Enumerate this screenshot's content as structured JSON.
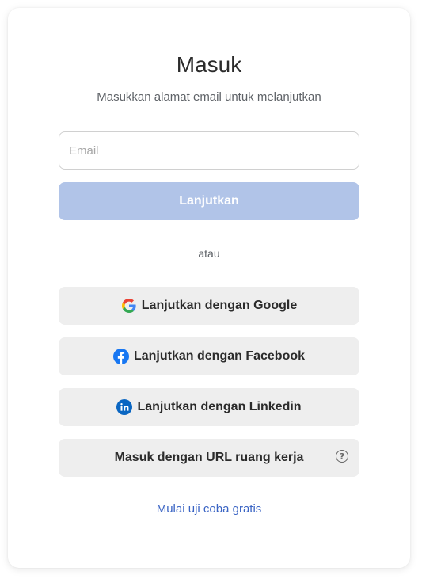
{
  "header": {
    "title": "Masuk",
    "subtitle": "Masukkan alamat email untuk melanjutkan"
  },
  "form": {
    "email_placeholder": "Email",
    "email_value": "",
    "continue_label": "Lanjutkan"
  },
  "divider": "atau",
  "social": {
    "google_label": "Lanjutkan dengan Google",
    "facebook_label": "Lanjutkan dengan Facebook",
    "linkedin_label": "Lanjutkan dengan Linkedin",
    "workspace_label": "Masuk dengan URL ruang kerja"
  },
  "footer": {
    "trial_link": "Mulai uji coba gratis"
  },
  "colors": {
    "primary_disabled": "#b1c4e8",
    "link": "#3a64c4",
    "facebook": "#1877f2",
    "linkedin": "#0a66c2"
  },
  "icons": {
    "google": "google-icon",
    "facebook": "facebook-icon",
    "linkedin": "linkedin-icon",
    "help": "help-circle-icon"
  }
}
